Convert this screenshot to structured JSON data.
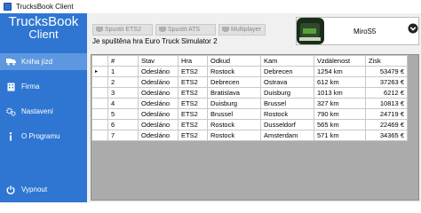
{
  "window": {
    "title": "TrucksBook Client"
  },
  "sidebar": {
    "brand_line1": "TrucksBook",
    "brand_line2": "Client",
    "items": [
      {
        "label": "Kniha jízd",
        "icon": "truck-icon",
        "active": true
      },
      {
        "label": "Firma",
        "icon": "building-icon",
        "active": false
      },
      {
        "label": "Nastavení",
        "icon": "gears-icon",
        "active": false
      },
      {
        "label": "O Programu",
        "icon": "info-icon",
        "active": false
      },
      {
        "label": "Vypnout",
        "icon": "power-icon",
        "active": false
      }
    ]
  },
  "toolbar": {
    "start_ets2": "Spustit ETS2",
    "start_ats": "Spustit ATS",
    "multiplayer": "Multiplayer"
  },
  "status": "Je spuštěna hra Euro Truck Simulator 2",
  "profile": {
    "name": "MiroS5"
  },
  "table": {
    "columns": [
      "#",
      "Stav",
      "Hra",
      "Odkud",
      "Kam",
      "Vzdálenost",
      "Zisk"
    ],
    "rows": [
      [
        "1",
        "Odesláno",
        "ETS2",
        "Rostock",
        "Debrecen",
        "1254 km",
        "53479 €"
      ],
      [
        "2",
        "Odesláno",
        "ETS2",
        "Debrecen",
        "Ostrava",
        "612 km",
        "37263 €"
      ],
      [
        "3",
        "Odesláno",
        "ETS2",
        "Bratislava",
        "Duisburg",
        "1013 km",
        "6212 €"
      ],
      [
        "4",
        "Odesláno",
        "ETS2",
        "Duisburg",
        "Brussel",
        "327 km",
        "10813 €"
      ],
      [
        "5",
        "Odesláno",
        "ETS2",
        "Brussel",
        "Rostock",
        "790 km",
        "24719 €"
      ],
      [
        "6",
        "Odesláno",
        "ETS2",
        "Rostock",
        "Dusseldorf",
        "565 km",
        "22469 €"
      ],
      [
        "7",
        "Odesláno",
        "ETS2",
        "Rostock",
        "Amsterdam",
        "571 km",
        "34365 €"
      ]
    ]
  }
}
